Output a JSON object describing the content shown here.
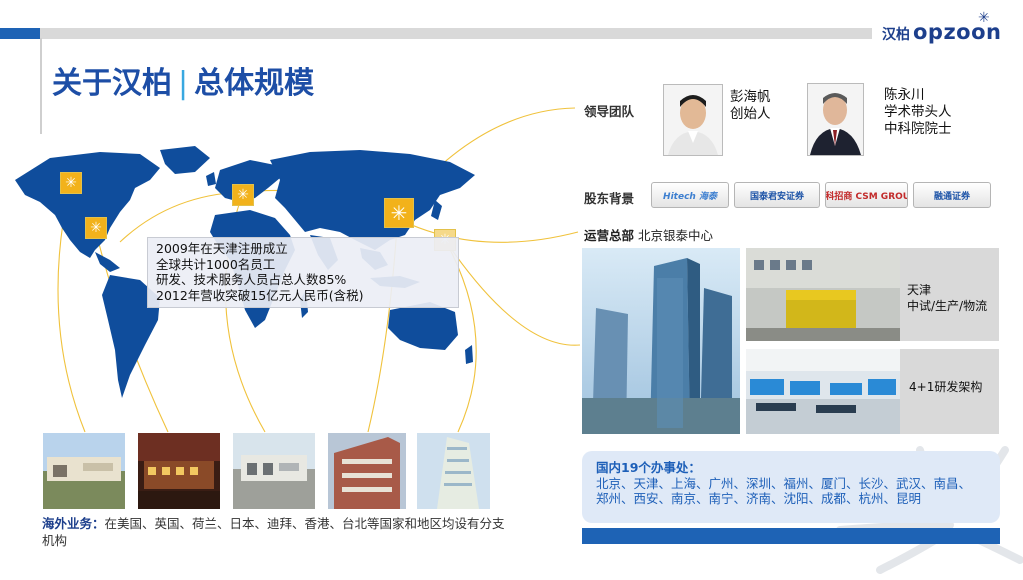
{
  "header": {
    "title_main": "关于汉柏",
    "title_sep": "|",
    "title_sub": "总体规模"
  },
  "logo": {
    "cn": "汉柏",
    "en": "OPZOON"
  },
  "info_box": {
    "lines": [
      "2009年在天津注册成立",
      "全球共计1000名员工",
      "研发、技术服务人员占总人数85%",
      "2012年营收突破15亿元人民币(含税)"
    ]
  },
  "overseas": {
    "label": "海外业务：",
    "text": "在美国、英国、荷兰、日本、迪拜、香港、台北等国家和地区均设有分支机构"
  },
  "leadership": {
    "label": "领导团队",
    "people": [
      {
        "name": "彭海帆",
        "title": "创始人"
      },
      {
        "name": "陈永川",
        "title": "学术带头人",
        "title2": "中科院院士"
      }
    ]
  },
  "shareholders": {
    "label": "股东背景",
    "logos": [
      "Hitech 海泰",
      "国泰君安证券",
      "中科招商 CSM GROUP",
      "融通证券"
    ]
  },
  "hq": {
    "label": "运营总部",
    "value": "北京银泰中心"
  },
  "tianjin_panel": {
    "line1": "天津",
    "line2": "中试/生产/物流"
  },
  "rd_panel": {
    "text": "4+1研发架构"
  },
  "offices": {
    "heading": "国内19个办事处：",
    "line1": "北京、天津、上海、广州、深圳、福州、厦门、长沙、武汉、南昌、",
    "line2": "郑州、西安、南京、南宁、济南、沈阳、成都、杭州、昆明"
  },
  "colors": {
    "brand_blue": "#1e63b5",
    "title_blue": "#1d4ea6",
    "map_blue": "#0f4d9c",
    "marker_yellow": "#f2b21b",
    "line_yellow": "#f0c23c"
  }
}
